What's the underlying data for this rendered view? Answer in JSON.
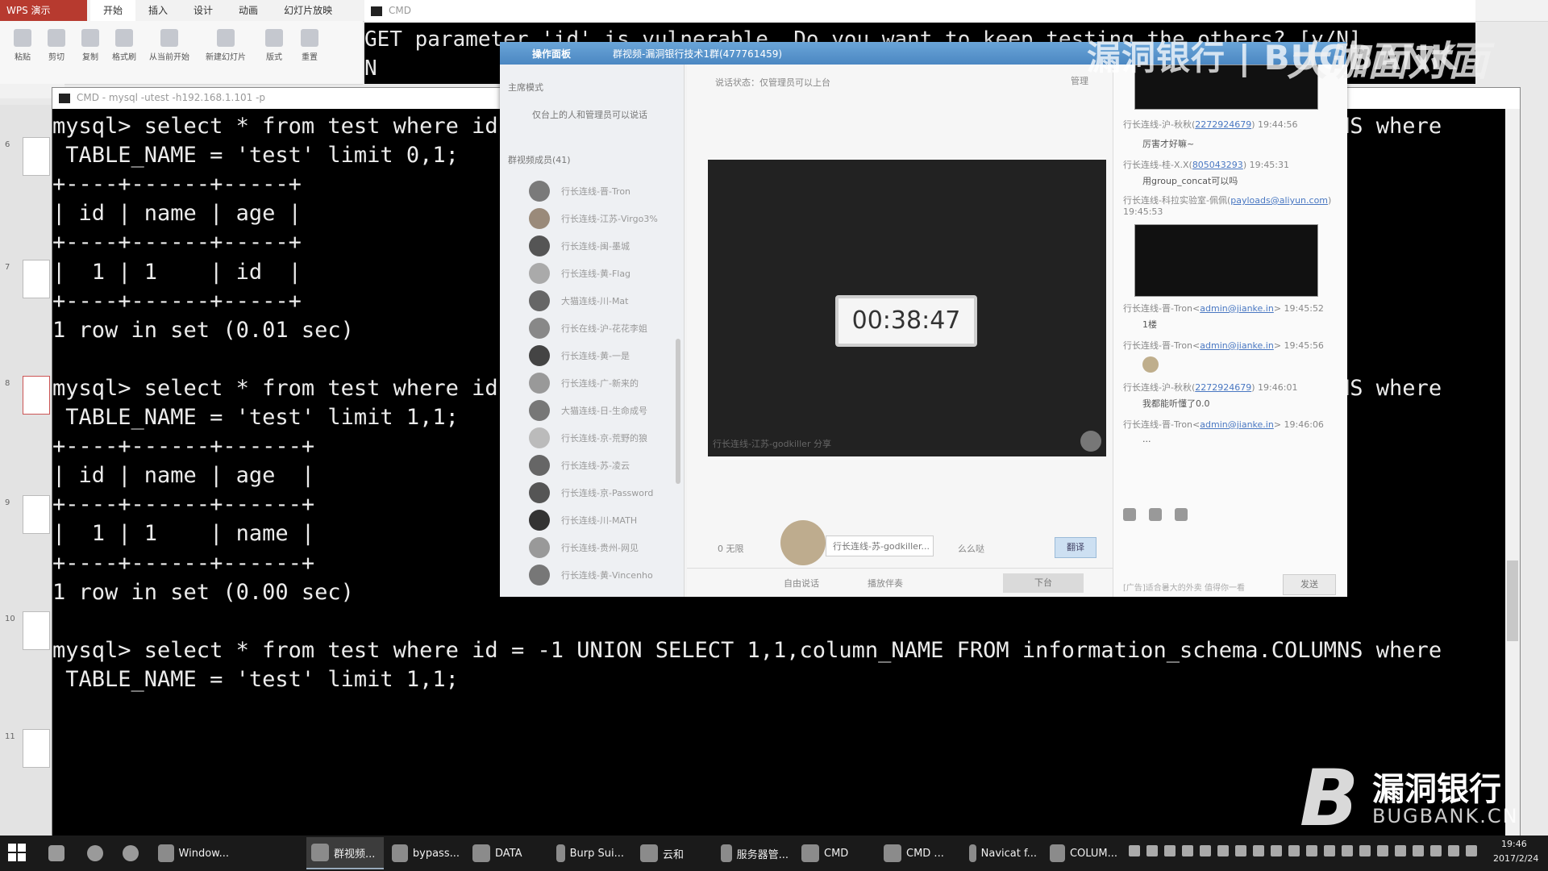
{
  "wps": {
    "app_name": "WPS 演示",
    "tabs": [
      "开始",
      "插入",
      "设计",
      "动画",
      "幻灯片放映"
    ],
    "ribbon": [
      "粘贴",
      "剪切",
      "复制",
      "格式刷",
      "从当前开始",
      "新建幻灯片",
      "版式",
      "重置"
    ],
    "slide_numbers": [
      "6",
      "7",
      "8",
      "9",
      "10",
      "11"
    ]
  },
  "cmd2": {
    "title": "CMD",
    "lines": [
      "GET parameter 'id' is vulnerable. Do you want to keep testing the others? [y/N]",
      "N"
    ]
  },
  "cmd1": {
    "title": "CMD - mysql -utest -h192.168.1.101 -p",
    "lines": [
      "mysql> select * from test where id = -1 UNION SELECT 1,1,column_NAME FROM information_schema.COLUMNS where",
      " TABLE_NAME = 'test' limit 0,1;",
      "+----+------+-----+",
      "| id | name | age |",
      "+----+------+-----+",
      "|  1 | 1    | id  |",
      "+----+------+-----+",
      "1 row in set (0.01 sec)",
      "",
      "mysql> select * from test where id = -1 UNION SELECT 1,1,column_NAME FROM information_schema.COLUMNS where",
      " TABLE_NAME = 'test' limit 1,1;",
      "+----+------+------+",
      "| id | name | age  |",
      "+----+------+------+",
      "|  1 | 1    | name |",
      "+----+------+------+",
      "1 row in set (0.00 sec)",
      "",
      "mysql> select * from test where id = -1 UNION SELECT 1,1,column_NAME FROM information_schema.COLUMNS where",
      " TABLE_NAME = 'test' limit 1,1;"
    ]
  },
  "qq": {
    "title": "操作面板",
    "group_title": "群视频-漏洞银行技术1群(477761459)",
    "mode": "主席模式",
    "left_hint": "仅台上的人和管理员可以说话",
    "members_header": "群视频成员(41)",
    "members": [
      "行长连线-晋-Tron",
      "行长连线-江苏-Virgo3%",
      "行长连线-闽-墨城",
      "行长连线-黄-Flag",
      "大猫连线-川-Mat",
      "行长在线-沪-花花李姐",
      "行长连线-黄-一是",
      "行长连线-广-新来的",
      "大猫连线-日-生命成号",
      "行长连线-京-荒野的狼",
      "行长连线-苏-凌云",
      "行长连线-京-Password",
      "行长连线-川-MATH",
      "行长连线-贵州-网见",
      "行长连线-黄-Vincenho"
    ],
    "status": "说话状态：仅管理员可以上台",
    "manage": "管理",
    "timer": "00:38:47",
    "video_caption": "行长连线-江苏-godkiller 分享",
    "mic_count": "0 无限",
    "speaker": "行长连线-苏-godkiller...",
    "reaction": "么么哒",
    "blue_button": "翻译",
    "free_talk": "自由说话",
    "play_music": "播放伴奏",
    "down_button": "下台",
    "chat": [
      {
        "sender": "行长连线-沪-秋秋",
        "qq": "2272924679",
        "time": "19:44:56",
        "msg": "厉害才好嘛~"
      },
      {
        "sender": "行长连线-桂-X.X",
        "qq": "805043293",
        "time": "19:45:31",
        "msg": "用group_concat可以吗"
      },
      {
        "sender": "行长连线-科拉实验室-佩佩",
        "qq": "payloads@aliyun.com",
        "time": "19:45:53",
        "msg": ""
      },
      {
        "sender": "行长连线-晋-Tron",
        "qq": "admin@jianke.in",
        "time": "19:45:52",
        "msg": "1楼"
      },
      {
        "sender": "行长连线-晋-Tron",
        "qq": "admin@jianke.in",
        "time": "19:45:56",
        "msg": ""
      },
      {
        "sender": "行长连线-沪-秋秋",
        "qq": "2272924679",
        "time": "19:46:01",
        "msg": "我都能听懂了0.0"
      },
      {
        "sender": "行长连线-晋-Tron",
        "qq": "admin@jianke.in",
        "time": "19:46:06",
        "msg": "..."
      }
    ],
    "input_ad": "[广告]适合暑大的外卖 值得你一看",
    "send": "发送"
  },
  "watermark": {
    "top_cn": "漏洞银行 | BUGBANK",
    "top_logo": "大咖面对面",
    "bottom_cn": "漏洞银行",
    "bottom_en": "BUGBANK.CN"
  },
  "taskbar": {
    "tasks": [
      {
        "label": "Window..."
      },
      {
        "label": "群视频..."
      },
      {
        "label": "bypass..."
      },
      {
        "label": "DATA"
      },
      {
        "label": "Burp Sui..."
      },
      {
        "label": "云和"
      },
      {
        "label": "服务器管..."
      },
      {
        "label": "CMD"
      },
      {
        "label": "CMD ..."
      },
      {
        "label": "Navicat f..."
      },
      {
        "label": "COLUM..."
      }
    ],
    "time": "19:46",
    "date": "2017/2/24"
  }
}
